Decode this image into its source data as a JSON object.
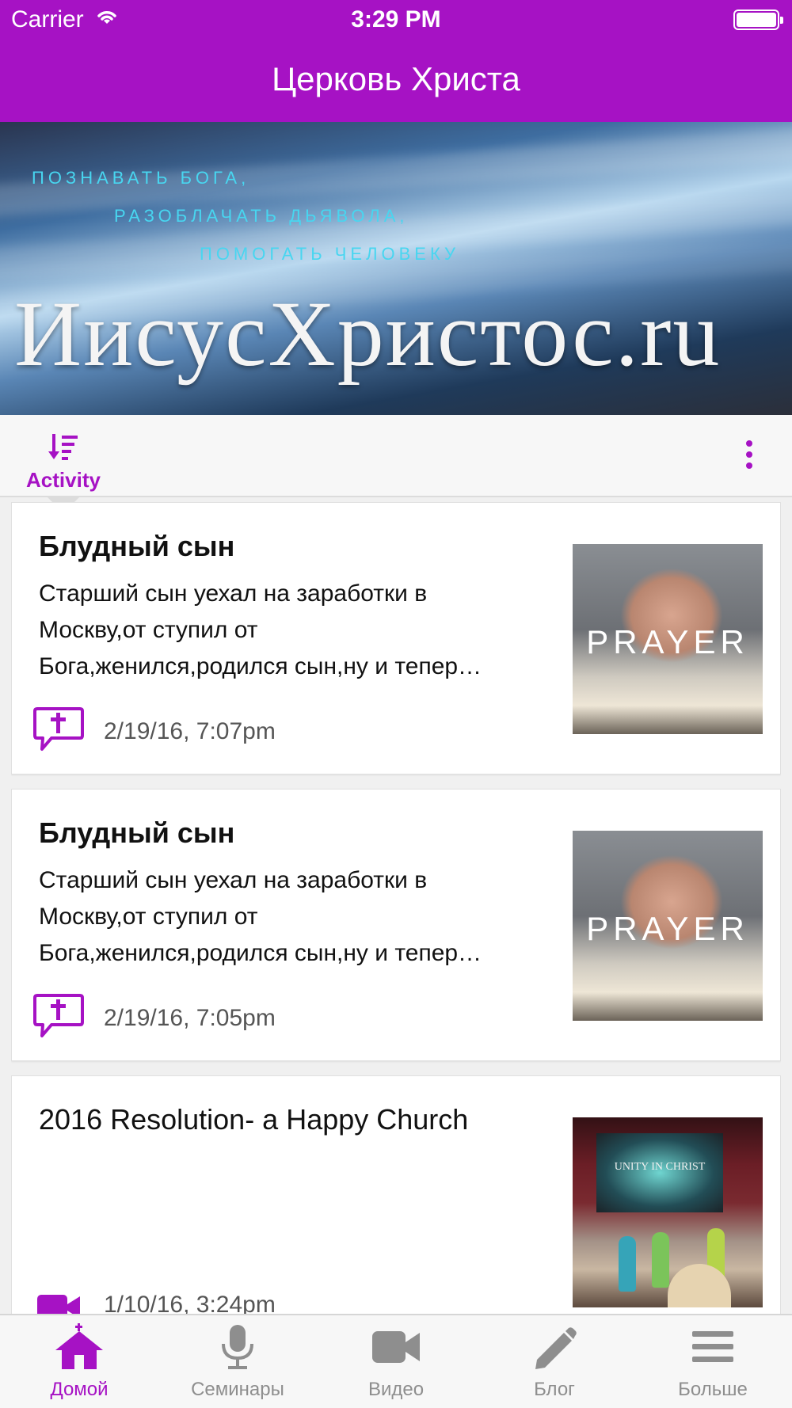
{
  "status_bar": {
    "carrier": "Carrier",
    "time": "3:29 PM"
  },
  "header": {
    "title": "Церковь Христа"
  },
  "banner": {
    "lines": [
      "ПОЗНАВАТЬ БОГА,",
      "РАЗОБЛАЧАТЬ ДЬЯВОЛА,",
      "ПОМОГАТЬ ЧЕЛОВЕКУ"
    ],
    "logo": "ИисусХристос.ru"
  },
  "toolbar": {
    "activity_label": "Activity",
    "sort_icon": "sort-icon",
    "more_icon": "more-vertical-icon"
  },
  "feed": [
    {
      "title": "Блудный сын",
      "excerpt_lines": [
        "Старший сын уехал на заработки в",
        "Москву,от ступил от",
        "Бога,женился,родился сын,ну и тепер…"
      ],
      "date": "2/19/16, 7:07pm",
      "icon": "prayer-bubble-icon",
      "thumb_text": "PRAYER"
    },
    {
      "title": "Блудный сын",
      "excerpt_lines": [
        "Старший сын уехал на заработки в",
        "Москву,от ступил от",
        "Бога,женился,родился сын,ну и тепер…"
      ],
      "date": "2/19/16, 7:05pm",
      "icon": "prayer-bubble-icon",
      "thumb_text": "PRAYER"
    },
    {
      "title": "2016 Resolution- a Happy Church",
      "excerpt_lines": [],
      "date": "1/10/16, 3:24pm",
      "icon": "video-camera-icon",
      "thumb_text": "UNITY IN CHRIST"
    }
  ],
  "tabbar": {
    "items": [
      {
        "label": "Домой",
        "icon": "home-icon",
        "active": true
      },
      {
        "label": "Семинары",
        "icon": "microphone-icon",
        "active": false
      },
      {
        "label": "Видео",
        "icon": "video-camera-icon",
        "active": false
      },
      {
        "label": "Блог",
        "icon": "pencil-icon",
        "active": false
      },
      {
        "label": "Больше",
        "icon": "menu-icon",
        "active": false
      }
    ]
  },
  "colors": {
    "accent": "#a612c4",
    "inactive": "#8e8e8e",
    "banner_text": "#48d6f0"
  }
}
